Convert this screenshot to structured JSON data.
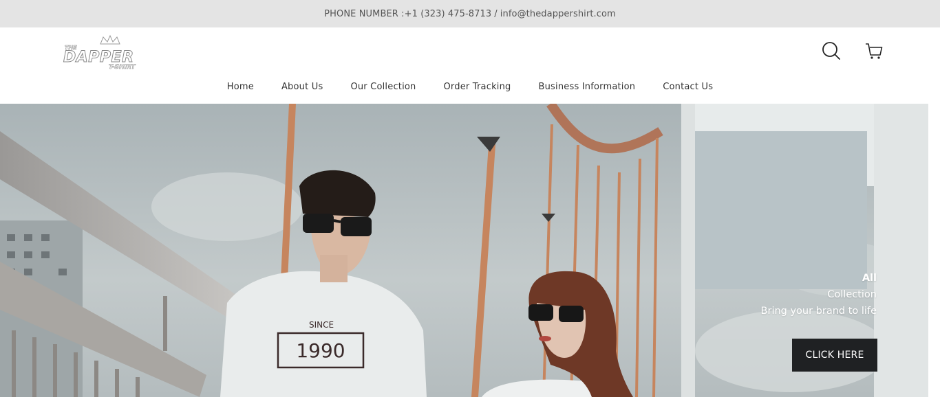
{
  "topbar": {
    "phone_label": "PHONE NUMBER :+1 (323) 475-8713",
    "separator": "/",
    "email": "info@thedappershirt.com"
  },
  "logo": {
    "brand_line1": "THE",
    "brand_line2": "DAPPER",
    "brand_line3": "T-SHIRT"
  },
  "header": {
    "icons": [
      "search-icon",
      "cart-icon"
    ]
  },
  "nav": {
    "items": [
      {
        "label": "Home"
      },
      {
        "label": "About Us"
      },
      {
        "label": "Our Collection"
      },
      {
        "label": "Order Tracking"
      },
      {
        "label": "Business Information"
      },
      {
        "label": "Contact Us"
      }
    ]
  },
  "hero": {
    "line1": "All",
    "line2": "Collection",
    "line3": "Bring your brand to life",
    "cta_label": "CLICK HERE",
    "shirt_since": "SINCE",
    "shirt_year": "1990"
  },
  "colors": {
    "topbar_bg": "#e4e4e4",
    "cta_bg": "#1f2123",
    "hero_text": "#ffffff"
  }
}
